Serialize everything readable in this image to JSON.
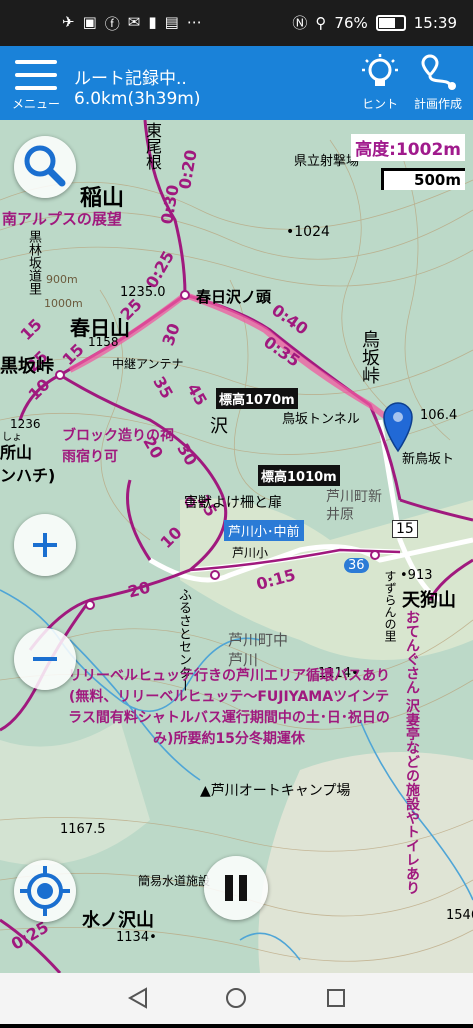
{
  "status_bar": {
    "battery_percent": "76%",
    "time": "15:39",
    "battery_level": 0.76
  },
  "app_bar": {
    "menu_label": "メニュー",
    "record_title": "ルート記録中..",
    "record_distance": "6.0km(3h39m)",
    "hint_label": "ヒント",
    "plan_label": "計画作成"
  },
  "map": {
    "elevation_readout": "高度:1002m",
    "scale_label": "500m",
    "labels": {
      "higashi_one": "東尾根",
      "inayama": "稲山",
      "minami_alps": "南アルプスの展望",
      "kurobayashi": "黒林坂道里",
      "m900": "900m",
      "m1000": "1000m",
      "kasugayama": "春日山",
      "kurosakatoge": "黒坂峠",
      "e1158": "1158",
      "chukei": "中継アンテナ",
      "e1235": "1235.0",
      "kasugasawa": "春日沢ノ頭",
      "e1024": "•1024",
      "kenritsu": "県立射撃場",
      "torisaka": "鳥坂峠",
      "block": "ブロック造りの祠",
      "amayadori": "雨宿り可",
      "sawa": "沢",
      "hyoko1070": "標高1070m",
      "torisaka_tunnel": "鳥坂トンネル",
      "e1064": "106.4",
      "shin_torisaka": "新鳥坂ト",
      "hyoko1010": "標高1010m",
      "gaiju": "害獣よけ柵と扉",
      "ashikawa_shin": "芦川町新井原",
      "bus_stop": "芦川小･中前",
      "ashikawa_sho": "芦川小",
      "route15": "15",
      "route36": "36",
      "e913": "•913",
      "tengu": "天狗山",
      "furusato": "ふるさとセンター",
      "ashikawa_naka": "芦川町中芦川",
      "e1114": "1114•",
      "suzuran": "すずらんの里",
      "oden": "おてんぐさん 沢妻亭などの施設やトイレあり",
      "bus_notice": "リリーベルヒュッテ行きの芦川エリア循環バスあり(無料、リリーベルヒュッテ～FUJIYAMAツインテラス間有料シャトルバス運行期間中の土･日･祝日のみ)所要約15分冬期運休",
      "camp": "芦川オートキャンプ場",
      "e11675": "1167.5",
      "kan_i": "簡易水道施設",
      "mizunosawa": "水ノ沢山",
      "e1134": "1134•",
      "e1546": "1546",
      "e1236": "1236",
      "tokoroyama": "所山",
      "nhachi": "ンハチ)",
      "shiyo": "しょ"
    },
    "times": [
      "0:20",
      "0:30",
      "0:25",
      "0:40",
      "0:35",
      "15",
      "25",
      "30",
      "45",
      "35",
      "20",
      "30",
      "15",
      "10",
      "10",
      "15",
      "25",
      "0:15",
      "20",
      "0:25"
    ]
  },
  "colors": {
    "app_bar": "#1a82d9",
    "route": "#a0197e",
    "track": "#f05aa0",
    "map_bg": "#bcd9c8"
  }
}
